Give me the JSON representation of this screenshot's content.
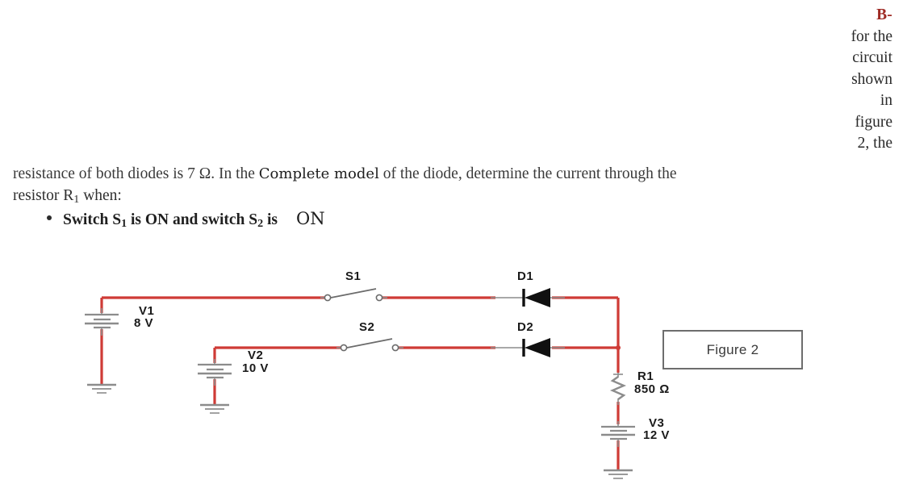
{
  "right_column": {
    "b_label": "B-",
    "lines": [
      "for the",
      "circuit",
      "shown",
      "in",
      "figure",
      "2,  the"
    ]
  },
  "paragraph": {
    "line1_part1": "resistance of both diodes is 7 Ω. In the ",
    "line1_inserted": "Complete model",
    "line1_part2": " of the diode, determine the current through the",
    "line2_part1": "resistor R",
    "line2_sub": "1",
    "line2_part2": " when:"
  },
  "bullet": {
    "text_part1": "Switch S",
    "sub1": "1",
    "text_part2": " is ON and switch  S",
    "sub2": "2",
    "text_part3": " is",
    "inserted_on": "ON"
  },
  "figure_box": {
    "label": "Figure 2"
  },
  "circuit": {
    "components": {
      "v1": {
        "name": "V1",
        "value": "8 V"
      },
      "v2": {
        "name": "V2",
        "value": "10 V"
      },
      "v3": {
        "name": "V3",
        "value": "12 V"
      },
      "r1": {
        "name": "R1",
        "value": "850 Ω"
      },
      "s1": {
        "name": "S1"
      },
      "s2": {
        "name": "S2"
      },
      "d1": {
        "name": "D1"
      },
      "d2": {
        "name": "D2"
      }
    },
    "colors": {
      "wire": "#cf3b36",
      "component": "#8c8c8c",
      "label": "#1a1a1a",
      "diode_fill": "#101010"
    }
  }
}
